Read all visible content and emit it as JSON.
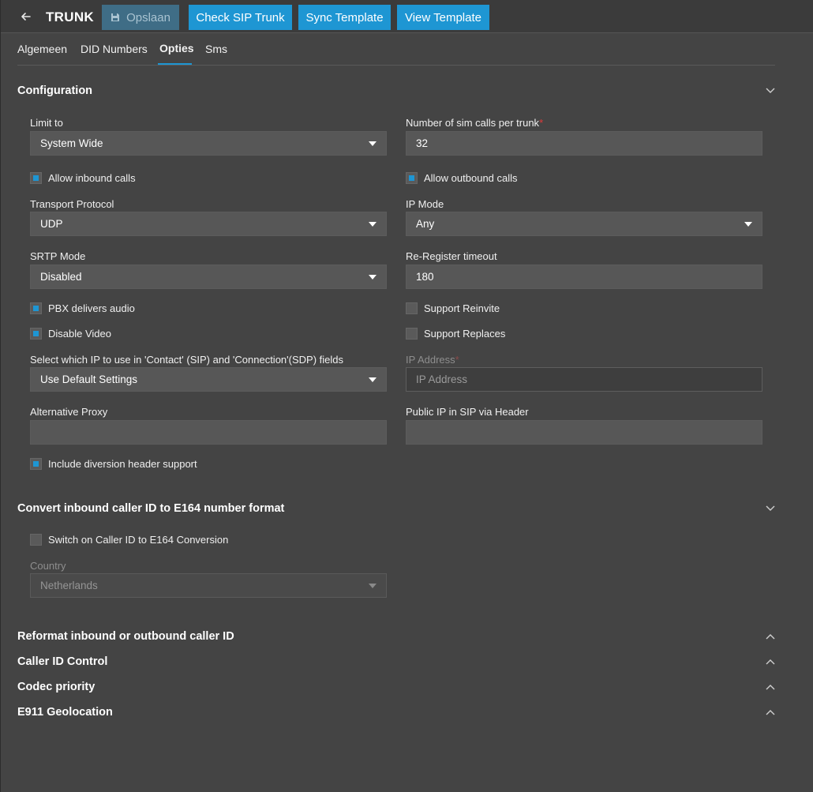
{
  "header": {
    "title": "TRUNK",
    "buttons": {
      "save": "Opslaan",
      "check_sip": "Check SIP Trunk",
      "sync_template": "Sync Template",
      "view_template": "View Template"
    }
  },
  "tabs": [
    "Algemeen",
    "DID Numbers",
    "Opties",
    "Sms"
  ],
  "active_tab": "Opties",
  "configuration": {
    "title": "Configuration",
    "limit_to": {
      "label": "Limit to",
      "value": "System Wide"
    },
    "sim_calls": {
      "label": "Number of sim calls per trunk",
      "value": "32"
    },
    "allow_inbound": {
      "label": "Allow inbound calls",
      "checked": true
    },
    "allow_outbound": {
      "label": "Allow outbound calls",
      "checked": true
    },
    "transport": {
      "label": "Transport Protocol",
      "value": "UDP"
    },
    "ip_mode": {
      "label": "IP Mode",
      "value": "Any"
    },
    "srtp": {
      "label": "SRTP Mode",
      "value": "Disabled"
    },
    "reregister": {
      "label": "Re-Register timeout",
      "value": "180"
    },
    "pbx_audio": {
      "label": "PBX delivers audio",
      "checked": true
    },
    "support_reinvite": {
      "label": "Support Reinvite",
      "checked": false
    },
    "disable_video": {
      "label": "Disable Video",
      "checked": true
    },
    "support_replaces": {
      "label": "Support Replaces",
      "checked": false
    },
    "contact_ip": {
      "label": "Select which IP to use in 'Contact' (SIP) and 'Connection'(SDP) fields",
      "value": "Use Default Settings"
    },
    "ip_address": {
      "label": "IP Address",
      "placeholder": "IP Address"
    },
    "alt_proxy": {
      "label": "Alternative Proxy",
      "value": ""
    },
    "public_ip": {
      "label": "Public IP in SIP via Header",
      "value": ""
    },
    "diversion": {
      "label": "Include diversion header support",
      "checked": true
    }
  },
  "e164": {
    "title": "Convert inbound caller ID to E164 number format",
    "switch": {
      "label": "Switch on Caller ID to E164 Conversion",
      "checked": false
    },
    "country": {
      "label": "Country",
      "value": "Netherlands"
    }
  },
  "collapsed_sections": [
    "Reformat inbound or outbound caller ID",
    "Caller ID Control",
    "Codec priority",
    "E911 Geolocation"
  ],
  "colors": {
    "accent": "#1e96d3",
    "background": "#444444",
    "required": "#e03a3a"
  }
}
